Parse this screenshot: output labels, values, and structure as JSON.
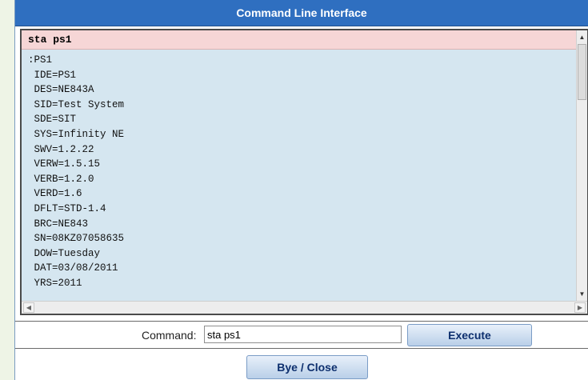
{
  "window": {
    "title": "Command Line Interface"
  },
  "console": {
    "command_echo": "sta ps1",
    "output_lines": [
      ":PS1",
      " IDE=PS1",
      " DES=NE843A",
      " SID=Test System",
      " SDE=SIT",
      " SYS=Infinity NE",
      " SWV=1.2.22",
      " VERW=1.5.15",
      " VERB=1.2.0",
      " VERD=1.6",
      " DFLT=STD-1.4",
      " BRC=NE843",
      " SN=08KZ07058635",
      " DOW=Tuesday",
      " DAT=03/08/2011",
      " YRS=2011"
    ]
  },
  "command_bar": {
    "label": "Command:",
    "input_value": "sta ps1",
    "execute_label": "Execute"
  },
  "footer": {
    "close_label": "Bye / Close"
  },
  "colors": {
    "title_bar": "#2f6fc0",
    "console_bg": "#d5e6f0",
    "echo_bg": "#f6d6d6",
    "button_text": "#0d2f6e"
  }
}
